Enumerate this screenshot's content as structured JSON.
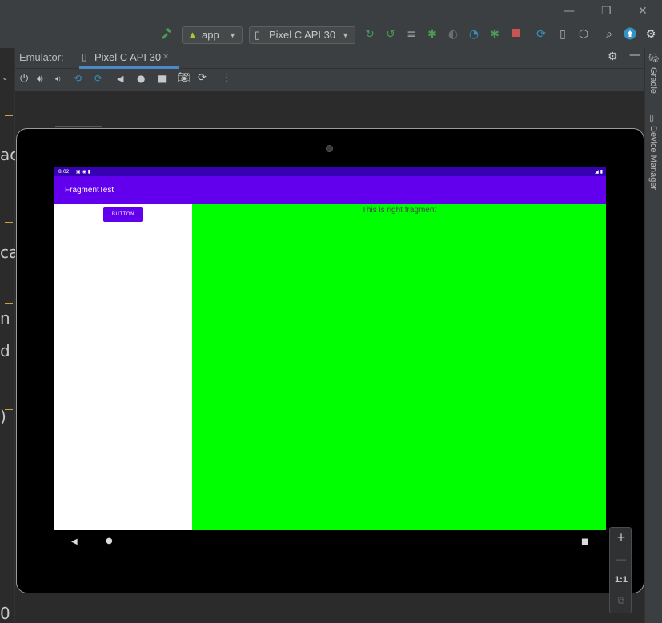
{
  "window": {
    "minimize": "—",
    "restore": "❐",
    "close": "✕"
  },
  "toolbar": {
    "hammer_icon": "hammer-icon",
    "run_config": "app",
    "device_select": "Pixel C API 30",
    "icons": [
      "apply-changes-icon",
      "apply-code-changes-icon",
      "logcat-icon",
      "debug-icon",
      "attach-debugger-icon",
      "profile-icon",
      "coverage-icon",
      "stop-icon",
      "sync-icon",
      "device-manager-icon",
      "sdk-manager-icon",
      "search-icon",
      "update-icon",
      "settings-icon"
    ]
  },
  "emulator": {
    "label": "Emulator:",
    "tab": "Pixel C API 30",
    "tab_close": "✕",
    "controls": [
      "power-icon",
      "volume-up-icon",
      "volume-down-icon",
      "rotate-left-icon",
      "rotate-right-icon",
      "back-icon",
      "home-icon",
      "overview-icon",
      "screenshot-icon",
      "snapshot-icon",
      "more-icon"
    ]
  },
  "device_screen": {
    "status_time": "8:02",
    "app_title": "FragmentTest",
    "button_label": "BUTTON",
    "right_fragment_text": "This is right fragment"
  },
  "zoom": {
    "plus": "+",
    "minus": "—",
    "one_to_one": "1:1"
  },
  "side_tools": {
    "gradle": "Gradle",
    "device_manager": "Device Manager"
  },
  "left_cutoff": [
    "ac",
    "ca",
    "n",
    "d",
    ")",
    "0"
  ],
  "colors": {
    "ide_bg": "#3c3f41",
    "status_bar": "#3700b3",
    "app_bar": "#6200ee",
    "right_fragment": "#00ff00",
    "green_icon": "#499c54",
    "stop_red": "#c75450"
  }
}
